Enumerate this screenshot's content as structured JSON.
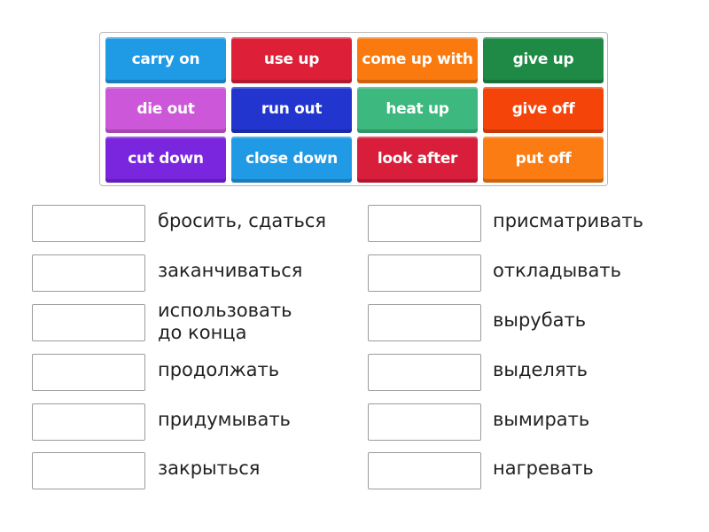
{
  "tiles": [
    {
      "label": "carry on",
      "color": "#1f9be6"
    },
    {
      "label": "use up",
      "color": "#dd1f37"
    },
    {
      "label": "come up with",
      "color": "#fb7a10"
    },
    {
      "label": "give up",
      "color": "#1e8a45"
    },
    {
      "label": "die out",
      "color": "#cc57d8"
    },
    {
      "label": "run out",
      "color": "#2235cf"
    },
    {
      "label": "heat up",
      "color": "#3db87f"
    },
    {
      "label": "give off",
      "color": "#f5440a"
    },
    {
      "label": "cut down",
      "color": "#7a26df"
    },
    {
      "label": "close down",
      "color": "#219ae6"
    },
    {
      "label": "look after",
      "color": "#d81e3a"
    },
    {
      "label": "put off",
      "color": "#fb7c12"
    }
  ],
  "definitions_left": [
    "бросить, сдаться",
    "заканчиваться",
    "использовать\nдо конца",
    "продолжать",
    "придумывать",
    "закрыться"
  ],
  "definitions_right": [
    "присматривать",
    "откладывать",
    "вырубать",
    "выделять",
    "вымирать",
    "нагревать"
  ]
}
